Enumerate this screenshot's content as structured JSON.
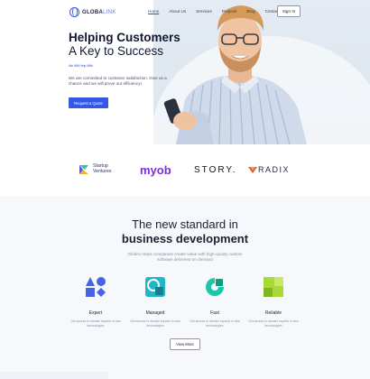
{
  "header": {
    "logo_main": "GLOBA",
    "logo_accent": "LINK",
    "nav": [
      "Home",
      "About Us",
      "Services",
      "Projects",
      "Blog",
      "Contact Us"
    ],
    "signin": "Sign In"
  },
  "hero": {
    "title_bold": "Helping Customers",
    "title_light": "A Key to Success",
    "small_link": "We Will Help With",
    "desc": "We are committed to customer satisfaction. Give us a chance and we will prove our efficiency!",
    "button": "Request a Quote"
  },
  "brands": {
    "startup_line1": "Startup",
    "startup_line2": "Ventures",
    "myob": "myob",
    "story": "STORY.",
    "radix": "RADIX"
  },
  "section": {
    "title_line1": "The new standard in",
    "title_line2": "business development",
    "desc": "Globex helps companies create value with high-quality custom software delivered on demand",
    "features": [
      {
        "title": "Expert",
        "desc": "Get access to domain experts in new technologies"
      },
      {
        "title": "Managed",
        "desc": "Get access to domain experts in new technologies"
      },
      {
        "title": "Fast",
        "desc": "Get access to domain experts in new technologies"
      },
      {
        "title": "Reliable",
        "desc": "Get access to domain experts in new technologies"
      }
    ],
    "view_more": "View More"
  },
  "colors": {
    "accent": "#3557e8",
    "expert": "#4a63e6",
    "managed": "#1fb8c9",
    "fast": "#17c9a6",
    "reliable": "#a8d83a"
  },
  "icons": [
    "globe-icon",
    "shapes-icon",
    "managed-icon",
    "fast-icon",
    "reliable-icon"
  ]
}
